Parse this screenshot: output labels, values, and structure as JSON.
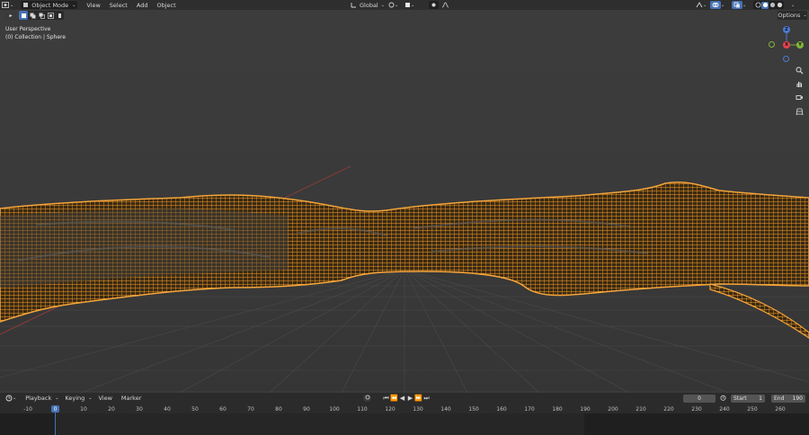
{
  "header": {
    "mode": "Object Mode",
    "menus": [
      "View",
      "Select",
      "Add",
      "Object"
    ],
    "transform_orientation": "Global",
    "options_label": "Options"
  },
  "viewport": {
    "view_name": "User Perspective",
    "collection_info": "(0) Collection | Sphere",
    "wire_color": "#f39a24",
    "gizmo": {
      "z": "Z",
      "y": "Y",
      "x": "X"
    }
  },
  "timeline": {
    "menus": [
      "Playback",
      "Keying",
      "View",
      "Marker"
    ],
    "current_frame": "0",
    "start_label": "Start",
    "start_value": "1",
    "end_label": "End",
    "end_value": "190",
    "ticks": [
      "-10",
      "0",
      "10",
      "20",
      "30",
      "40",
      "50",
      "60",
      "70",
      "80",
      "90",
      "100",
      "110",
      "120",
      "130",
      "140",
      "150",
      "160",
      "170",
      "180",
      "190",
      "200",
      "210",
      "220",
      "230",
      "240",
      "250",
      "260"
    ]
  }
}
